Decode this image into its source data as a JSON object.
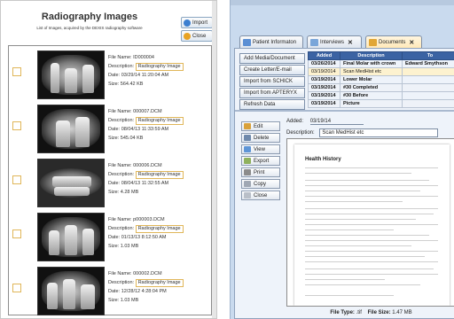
{
  "left_panel": {
    "title": "Radiography Images",
    "subtitle": "List of Images, acquired by the DEXIS radiography software",
    "import_label": "Import",
    "close_label": "Close",
    "labels": {
      "file_name": "File Name:",
      "description": "Description:",
      "date": "Date:",
      "size": "Size:"
    },
    "items": [
      {
        "file_name": "ID000004",
        "description": "Radiography Image",
        "date": "03/29/14 11:20:04 AM",
        "size": "564.42 KB"
      },
      {
        "file_name": "000007.DCM",
        "description": "Radiography Image",
        "date": "08/04/13 11:33:59 AM",
        "size": "545.04 KB"
      },
      {
        "file_name": "000006.DCM",
        "description": "Radiography Image",
        "date": "08/04/13 11:32:55 AM",
        "size": "4.28 MB"
      },
      {
        "file_name": "p000003.DCM",
        "description": "Radiography Image",
        "date": "01/13/13 8:12:50 AM",
        "size": "1.03 MB"
      },
      {
        "file_name": "000002.DCM",
        "description": "Radiography Image",
        "date": "12/28/12 4:28:04 PM",
        "size": "1.03 MB"
      }
    ]
  },
  "right_panel": {
    "tabs": [
      {
        "label": "Patient Informaton"
      },
      {
        "label": "Interviews"
      },
      {
        "label": "Documents"
      }
    ],
    "actions": [
      "Add Media/Document",
      "Create Letter/E-mail",
      "Import from SCHICK",
      "Import from APTERYX",
      "Refresh Data"
    ],
    "table": {
      "headers": [
        "Added",
        "Description",
        "To"
      ],
      "rows": [
        {
          "added": "03/26/2014",
          "description": "Final Molar with crown",
          "to": "Edward Smythson"
        },
        {
          "added": "03/19/2014",
          "description": "Scan MedHist etc",
          "to": ""
        },
        {
          "added": "03/19/2014",
          "description": "Lower Molar",
          "to": ""
        },
        {
          "added": "03/19/2014",
          "description": "#30 Completed",
          "to": ""
        },
        {
          "added": "03/19/2014",
          "description": "#30 Before",
          "to": ""
        },
        {
          "added": "03/19/2014",
          "description": "Picture",
          "to": ""
        }
      ]
    },
    "tools": [
      "Edit",
      "Delete",
      "View",
      "Export",
      "Print",
      "Copy",
      "Close"
    ],
    "detail": {
      "added_label": "Added:",
      "added_value": "03/19/14",
      "description_label": "Description:",
      "description_value": "Scan MedHist etc"
    },
    "preview": {
      "heading": "Health History"
    },
    "file_info": {
      "type_label": "File Type:",
      "type_value": ".tif",
      "size_label": "File Size:",
      "size_value": "1.47 MB"
    }
  }
}
